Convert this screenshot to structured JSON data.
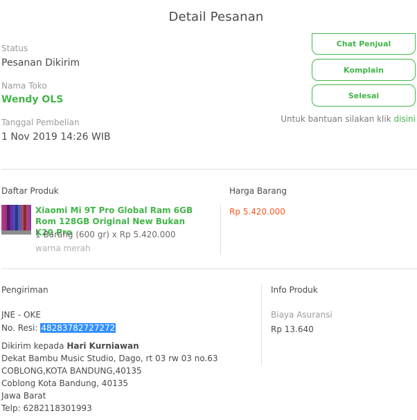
{
  "header": {
    "title": "Detail Pesanan"
  },
  "order": {
    "status_label": "Status",
    "status_value": "Pesanan Dikirim",
    "store_label": "Nama Toko",
    "store_name": "Wendy OLS",
    "date_label": "Tanggal Pembelian",
    "date_value": "1 Nov 2019 14:26 WIB"
  },
  "actions": {
    "chat_label": "Chat Penjual",
    "complain_label": "Komplain",
    "done_label": "Selesai",
    "help_text": "Untuk bantuan silakan klik",
    "help_link": "disini"
  },
  "products": {
    "list_label": "Daftar Produk",
    "price_label": "Harga Barang",
    "items": [
      {
        "name": "Xiaomi Mi 9T Pro Global Ram 6GB Rom 128GB Original New Bukan K20 Pro",
        "qty_line": "1 Barang (600 gr) x Rp 5.420.000",
        "variant": "warna merah",
        "price": "Rp 5.420.000"
      }
    ]
  },
  "shipping": {
    "label": "Pengiriman",
    "courier": "JNE - OKE",
    "resi_label": "No. Resi:",
    "resi_value": "48283782727272",
    "sent_to_prefix": "Dikirim kepada",
    "recipient": "Hari Kurniawan",
    "address_lines": [
      "Dekat Bambu Music Studio, Dago, rt 03 rw 03 no.63",
      "COBLONG,KOTA BANDUNG,40135",
      "Coblong Kota Bandung, 40135",
      "Jawa Barat",
      "Telp: 6282118301993"
    ]
  },
  "product_info": {
    "label": "Info Produk",
    "insurance_label": "Biaya Asuransi",
    "insurance_value": "Rp 13.640"
  },
  "colors": {
    "accent": "#42b549",
    "price": "#ff5722",
    "highlight": "#3390ff"
  }
}
